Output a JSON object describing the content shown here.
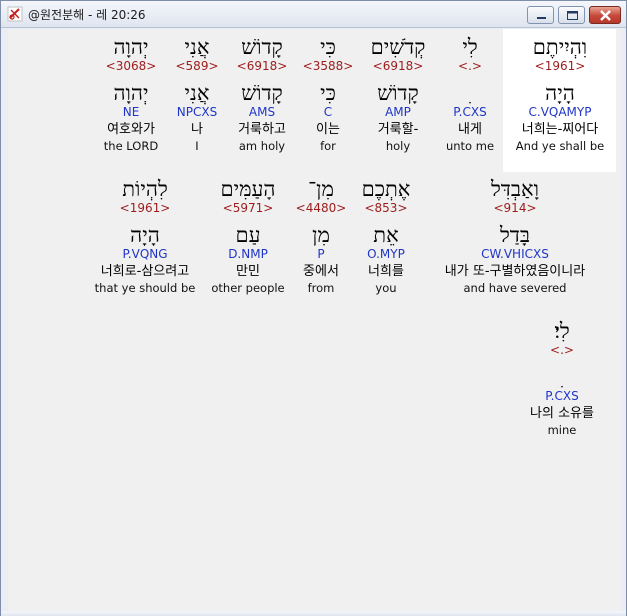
{
  "window": {
    "title": "@원전분해 - 레 20:26"
  },
  "lines": [
    {
      "words": [
        {
          "heb": "וִהְיִיתֶם",
          "strong": "<1961>",
          "lemma": "הָיָה",
          "morph": "C.VQAMYP",
          "kor": "너희는-찌어다",
          "eng": "And ye shall be",
          "selected": true
        },
        {
          "heb": "לִי",
          "strong": "<.>",
          "lemma": "ִ",
          "morph": "P.CXS",
          "kor": "내게",
          "eng": "unto me"
        },
        {
          "heb": "קְדֹשִׁים",
          "strong": "<6918>",
          "lemma": "קָדוֹשׁ",
          "morph": "AMP",
          "kor": "거룩할-",
          "eng": "holy"
        },
        {
          "heb": "כִּי",
          "strong": "<3588>",
          "lemma": "כִּי",
          "morph": "C",
          "kor": "이는",
          "eng": "for"
        },
        {
          "heb": "קָדוֹשׁ",
          "strong": "<6918>",
          "lemma": "קָדוֹשׁ",
          "morph": "AMS",
          "kor": "거룩하고",
          "eng": "am holy"
        },
        {
          "heb": "אֲנִי",
          "strong": "<589>",
          "lemma": "אֲנִי",
          "morph": "NPCXS",
          "kor": "나",
          "eng": "I"
        },
        {
          "heb": "יְהוָה",
          "strong": "<3068>",
          "lemma": "יְהוָה",
          "morph": "NE",
          "kor": "여호와가",
          "eng": "the LORD"
        }
      ]
    },
    {
      "words": [
        {
          "heb": "וָאַבְדִּל",
          "strong": "<914>",
          "lemma": "בָּדַל",
          "morph": "CW.VHICXS",
          "kor": "내가 또-구별하였음이니라",
          "eng": "and have severed"
        },
        {
          "heb": "אֶתְכֶם",
          "strong": "<853>",
          "lemma": "אֵת",
          "morph": "O.MYP",
          "kor": "너희를",
          "eng": "you"
        },
        {
          "heb": "מִן־",
          "strong": "<4480>",
          "lemma": "מִן",
          "morph": "P",
          "kor": "중에서",
          "eng": "from"
        },
        {
          "heb": "הָעַמִּים",
          "strong": "<5971>",
          "lemma": "עַם",
          "morph": "D.NMP",
          "kor": "만민",
          "eng": "other people"
        },
        {
          "heb": "לִהְיוֹת",
          "strong": "<1961>",
          "lemma": "הָיָה",
          "morph": "P.VQNG",
          "kor": "너희로-삼으려고",
          "eng": "that ye should be"
        }
      ]
    },
    {
      "words": [
        {
          "heb": "לִי׃",
          "strong": "<.>",
          "lemma": "ִ",
          "morph": "P.CXS",
          "kor": "나의 소유를",
          "eng": "mine"
        }
      ]
    }
  ]
}
